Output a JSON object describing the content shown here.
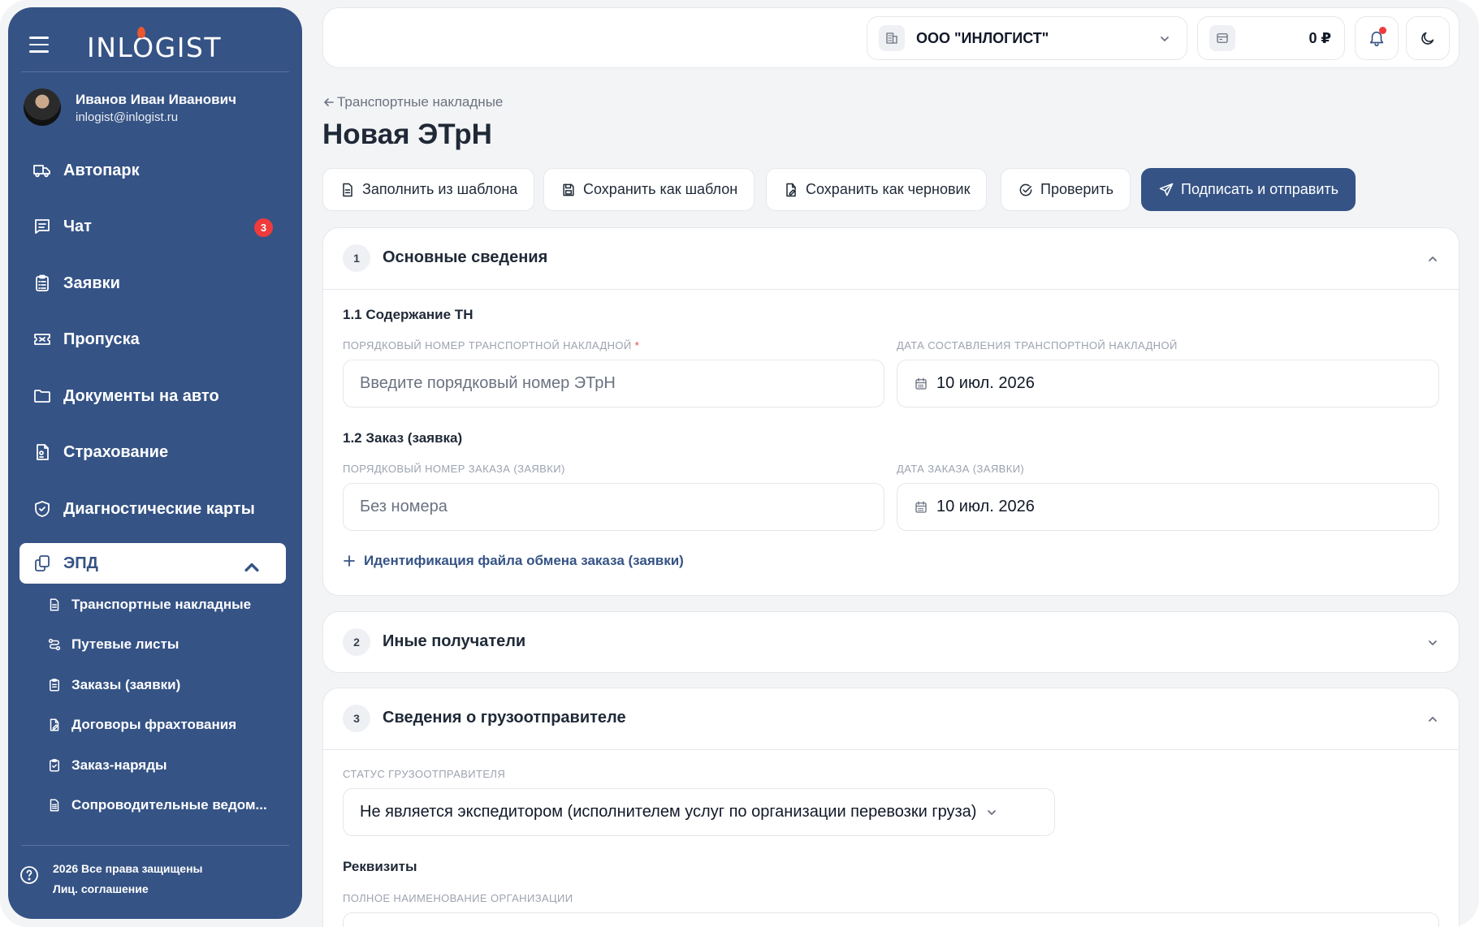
{
  "app": {
    "logo": "INLOGIST",
    "user": {
      "name": "Иванов Иван Иванович",
      "email": "inlogist@inlogist.ru"
    },
    "nav": [
      {
        "label": "Автопарк",
        "icon": "truck-icon"
      },
      {
        "label": "Чат",
        "icon": "chat-icon",
        "badge": "3"
      },
      {
        "label": "Заявки",
        "icon": "clipboard-icon"
      },
      {
        "label": "Пропуска",
        "icon": "ticket-icon"
      },
      {
        "label": "Документы на авто",
        "icon": "folder-icon"
      },
      {
        "label": "Страхование",
        "icon": "insurance-icon"
      },
      {
        "label": "Диагностические карты",
        "icon": "shield-icon"
      },
      {
        "label": "ЭПД",
        "icon": "copy-icon"
      }
    ],
    "sub_nav": [
      {
        "label": "Транспортные накладные",
        "icon": "document-icon"
      },
      {
        "label": "Путевые листы",
        "icon": "route-icon"
      },
      {
        "label": "Заказы (заявки)",
        "icon": "clipboard-list-icon"
      },
      {
        "label": "Договоры фрахтования",
        "icon": "contract-icon"
      },
      {
        "label": "Заказ-наряды",
        "icon": "clipboard-check-icon"
      },
      {
        "label": "Сопроводительные ведом...",
        "icon": "document-list-icon"
      }
    ],
    "footer": {
      "copyright": "2026 Все права защищены",
      "license": "Лиц. соглашение"
    }
  },
  "header": {
    "company": "ООО \"ИНЛОГИСТ\"",
    "balance": "0 ₽"
  },
  "page": {
    "back_label": "Транспортные накладные",
    "title": "Новая ЭТрН",
    "actions": [
      "Заполнить из шаблона",
      "Сохранить как шаблон",
      "Сохранить как черновик",
      "Проверить",
      "Подписать и отправить"
    ]
  },
  "sections": {
    "s1": {
      "num": "1",
      "title": "Основные сведения",
      "sub1": "1.1 Содержание ТН",
      "label_number": "ПОРЯДКОВЫЙ НОМЕР ТРАНСПОРТНОЙ НАКЛАДНОЙ",
      "required_mark": "*",
      "placeholder_number": "Введите порядковый номер ЭТрН",
      "label_date": "ДАТА СОСТАВЛЕНИЯ ТРАНСПОРТНОЙ НАКЛАДНОЙ",
      "date_value": "10 июл. 2026",
      "sub2": "1.2 Заказ (заявка)",
      "label_order_number": "ПОРЯДКОВЫЙ НОМЕР ЗАКАЗА (ЗАЯВКИ)",
      "placeholder_order": "Без номера",
      "label_order_date": "ДАТА ЗАКАЗА (ЗАЯВКИ)",
      "order_date_value": "10 июл. 2026",
      "add_link": "Идентификация файла обмена заказа (заявки)"
    },
    "s2": {
      "num": "2",
      "title": "Иные получатели"
    },
    "s3": {
      "num": "3",
      "title": "Сведения о грузоотправителе",
      "label_status": "СТАТУС ГРУЗООТПРАВИТЕЛЯ",
      "status_value": "Не является экспедитором (исполнителем услуг по организации перевозки груза)",
      "sub_requisites": "Реквизиты",
      "label_full_name": "ПОЛНОЕ НАИМЕНОВАНИЕ ОРГАНИЗАЦИИ"
    }
  },
  "colors": {
    "brand": "#355385",
    "badge": "#ef3b3b",
    "logo_accent": "#e8572f"
  }
}
